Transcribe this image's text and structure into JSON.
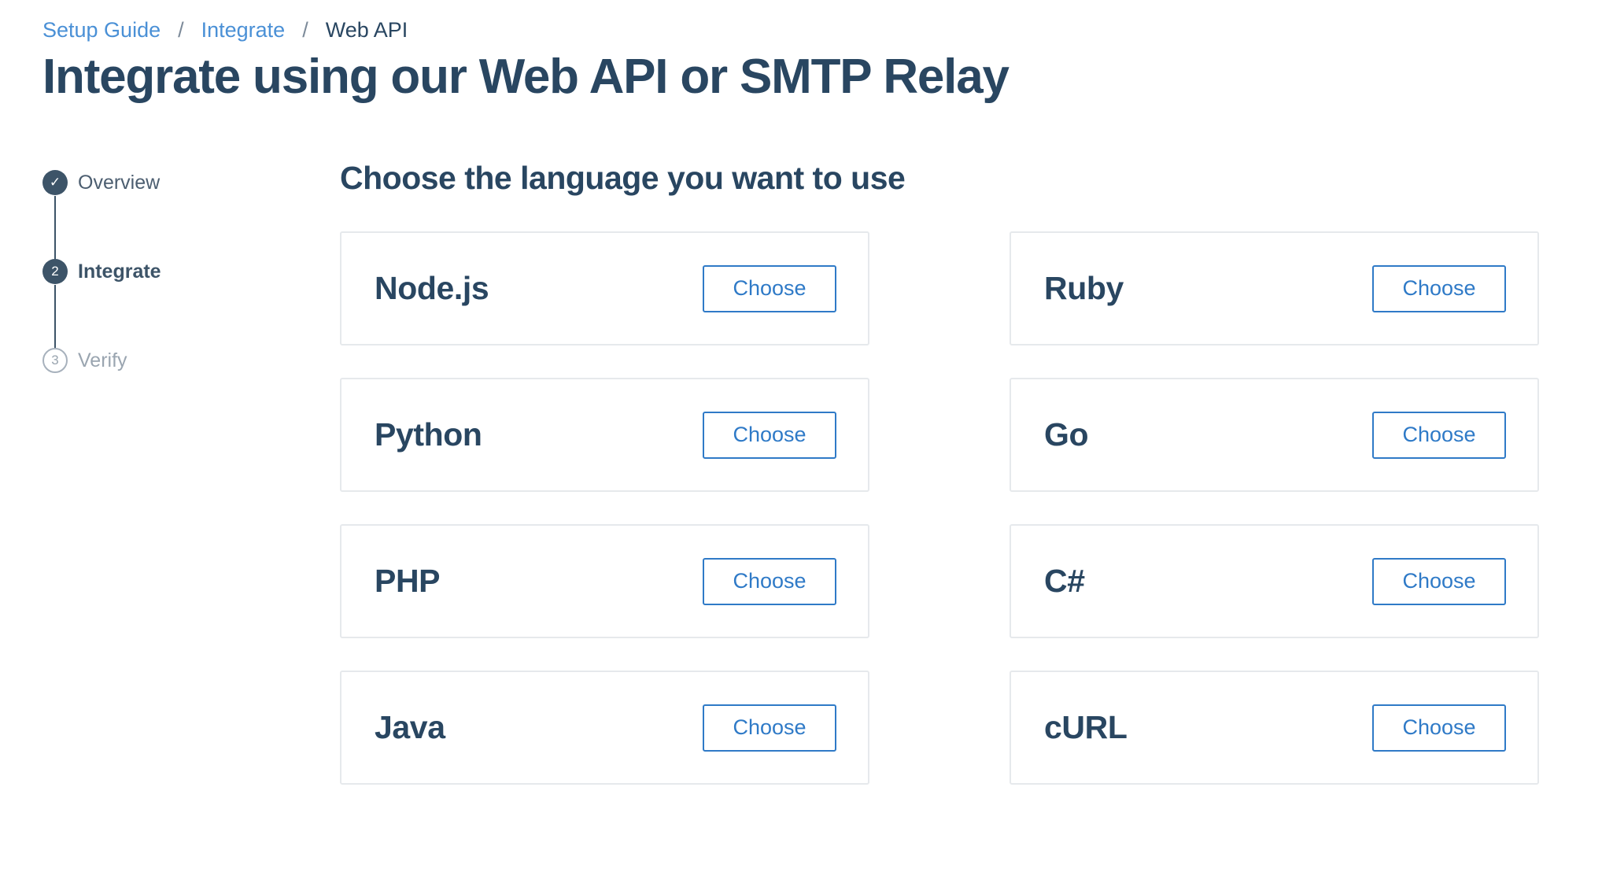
{
  "breadcrumb": {
    "items": [
      {
        "label": "Setup Guide"
      },
      {
        "label": "Integrate"
      }
    ],
    "separator": "/",
    "current": "Web API"
  },
  "page_title": "Integrate using our Web API or SMTP Relay",
  "stepper": {
    "steps": [
      {
        "label": "Overview",
        "marker": "✓",
        "state": "complete"
      },
      {
        "label": "Integrate",
        "marker": "2",
        "state": "active"
      },
      {
        "label": "Verify",
        "marker": "3",
        "state": "pending"
      }
    ]
  },
  "section_title": "Choose the language you want to use",
  "languages": [
    {
      "name": "Node.js",
      "button": "Choose"
    },
    {
      "name": "Ruby",
      "button": "Choose"
    },
    {
      "name": "Python",
      "button": "Choose"
    },
    {
      "name": "Go",
      "button": "Choose"
    },
    {
      "name": "PHP",
      "button": "Choose"
    },
    {
      "name": "C#",
      "button": "Choose"
    },
    {
      "name": "Java",
      "button": "Choose"
    },
    {
      "name": "cURL",
      "button": "Choose"
    }
  ],
  "colors": {
    "heading": "#294661",
    "link": "#4a90d6",
    "button_accent": "#2f7ac7",
    "step_active": "#3d5468",
    "step_pending": "#9aa5b0",
    "card_border": "#e6e9ec"
  }
}
